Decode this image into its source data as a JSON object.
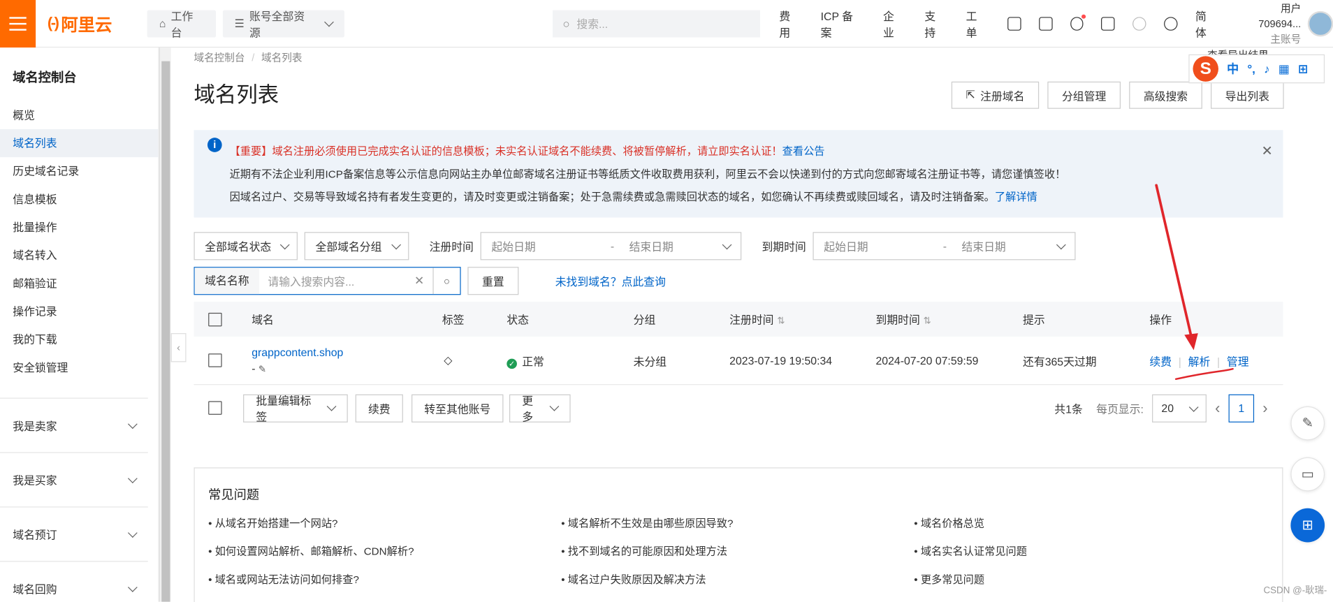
{
  "topbar": {
    "logo_text": "阿里云",
    "workbench": "工作台",
    "resources": "账号全部资源",
    "search_placeholder": "搜索...",
    "links": [
      "费用",
      "ICP 备案",
      "企业",
      "支持",
      "工单"
    ],
    "lang": "简体",
    "user_name": "用户709694...",
    "user_role": "主账号"
  },
  "sidebar": {
    "title": "域名控制台",
    "items": [
      {
        "label": "概览"
      },
      {
        "label": "域名列表",
        "active": true
      },
      {
        "label": "历史域名记录"
      },
      {
        "label": "信息模板"
      },
      {
        "label": "批量操作"
      },
      {
        "label": "域名转入"
      },
      {
        "label": "邮箱验证"
      },
      {
        "label": "操作记录"
      },
      {
        "label": "我的下载"
      },
      {
        "label": "安全锁管理"
      }
    ],
    "groups": [
      "我是卖家",
      "我是买家",
      "域名预订",
      "域名回购"
    ]
  },
  "main": {
    "breadcrumb": [
      "域名控制台",
      "域名列表"
    ],
    "title": "域名列表",
    "view_export": "查看导出结果",
    "head_buttons": [
      "注册域名",
      "分组管理",
      "高级搜索",
      "导出列表"
    ],
    "notice": {
      "line1": "【重要】域名注册必须使用已完成实名认证的信息模板；未实名认证域名不能续费、将被暂停解析，请立即实名认证！",
      "line1_link": "查看公告",
      "line2": "近期有不法企业利用ICP备案信息等公示信息向网站主办单位邮寄域名注册证书等纸质文件收取费用获利，阿里云不会以快递到付的方式向您邮寄域名注册证书等，请您谨慎签收！",
      "line3": "因域名过户、交易等导致域名持有者发生变更的，请及时变更或注销备案；处于急需续费或急需赎回状态的域名，如您确认不再续费或赎回域名，请及时注销备案。",
      "line3_link": "了解详情"
    },
    "filters": {
      "status": "全部域名状态",
      "group": "全部域名分组",
      "reg_label": "注册时间",
      "exp_label": "到期时间",
      "start": "起始日期",
      "end": "结束日期",
      "dash": "-",
      "search_prefix": "域名名称",
      "search_placeholder": "请输入搜索内容...",
      "reset": "重置",
      "not_found": "未找到域名？点此查询"
    },
    "table": {
      "headers": [
        "域名",
        "标签",
        "状态",
        "分组",
        "注册时间",
        "到期时间",
        "提示",
        "操作"
      ],
      "row": {
        "domain": "grappcontent.shop",
        "remark": "-",
        "status": "正常",
        "group": "未分组",
        "reg_time": "2023-07-19 19:50:34",
        "exp_time": "2024-07-20 07:59:59",
        "tip": "还有365天过期",
        "ops": [
          "续费",
          "解析",
          "管理"
        ]
      }
    },
    "bottom": {
      "batch_tag": "批量编辑标签",
      "renew": "续费",
      "transfer": "转至其他账号",
      "more": "更多",
      "total": "共1条",
      "per_page_label": "每页显示:",
      "per_page": "20",
      "page": "1"
    },
    "faq": {
      "title": "常见问题",
      "items": [
        "• 从域名开始搭建一个网站?",
        "• 域名解析不生效是由哪些原因导致?",
        "• 域名价格总览",
        "• 如何设置网站解析、邮箱解析、CDN解析?",
        "• 找不到域名的可能原因和处理方法",
        "• 域名实名认证常见问题",
        "• 域名或网站无法访问如何排查?",
        "• 域名过户失败原因及解决方法",
        "• 更多常见问题"
      ]
    }
  },
  "ime": {
    "logo": "S",
    "mode": "中",
    "punct": "°,"
  },
  "watermark": "CSDN @-耿瑞-",
  "colors": {
    "brand": "#ff6a00",
    "link": "#0064c8",
    "annotation": "#e0262b"
  }
}
